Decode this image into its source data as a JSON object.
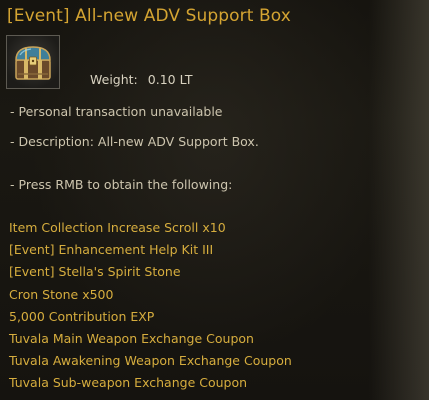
{
  "item": {
    "title": "[Event] All-new ADV Support Box",
    "icon": "treasure-chest-icon",
    "weight_label": "Weight:",
    "weight_value": "0.10 LT",
    "dash": "-",
    "transaction": "Personal transaction unavailable",
    "description": "Description: All-new ADV Support Box.",
    "instruction": "Press RMB to obtain the following:"
  },
  "rewards": [
    "Item Collection Increase Scroll x10",
    "[Event] Enhancement Help Kit III",
    "[Event] Stella's Spirit Stone",
    "Cron Stone x500",
    "5,000 Contribution EXP",
    "Tuvala Main Weapon Exchange Coupon",
    "Tuvala Awakening Weapon Exchange Coupon",
    "Tuvala Sub-weapon Exchange Coupon"
  ],
  "colors": {
    "title": "#d4a432",
    "reward": "#d6ad3e",
    "body_text": "#cdc5ae",
    "background": "#16140f"
  }
}
